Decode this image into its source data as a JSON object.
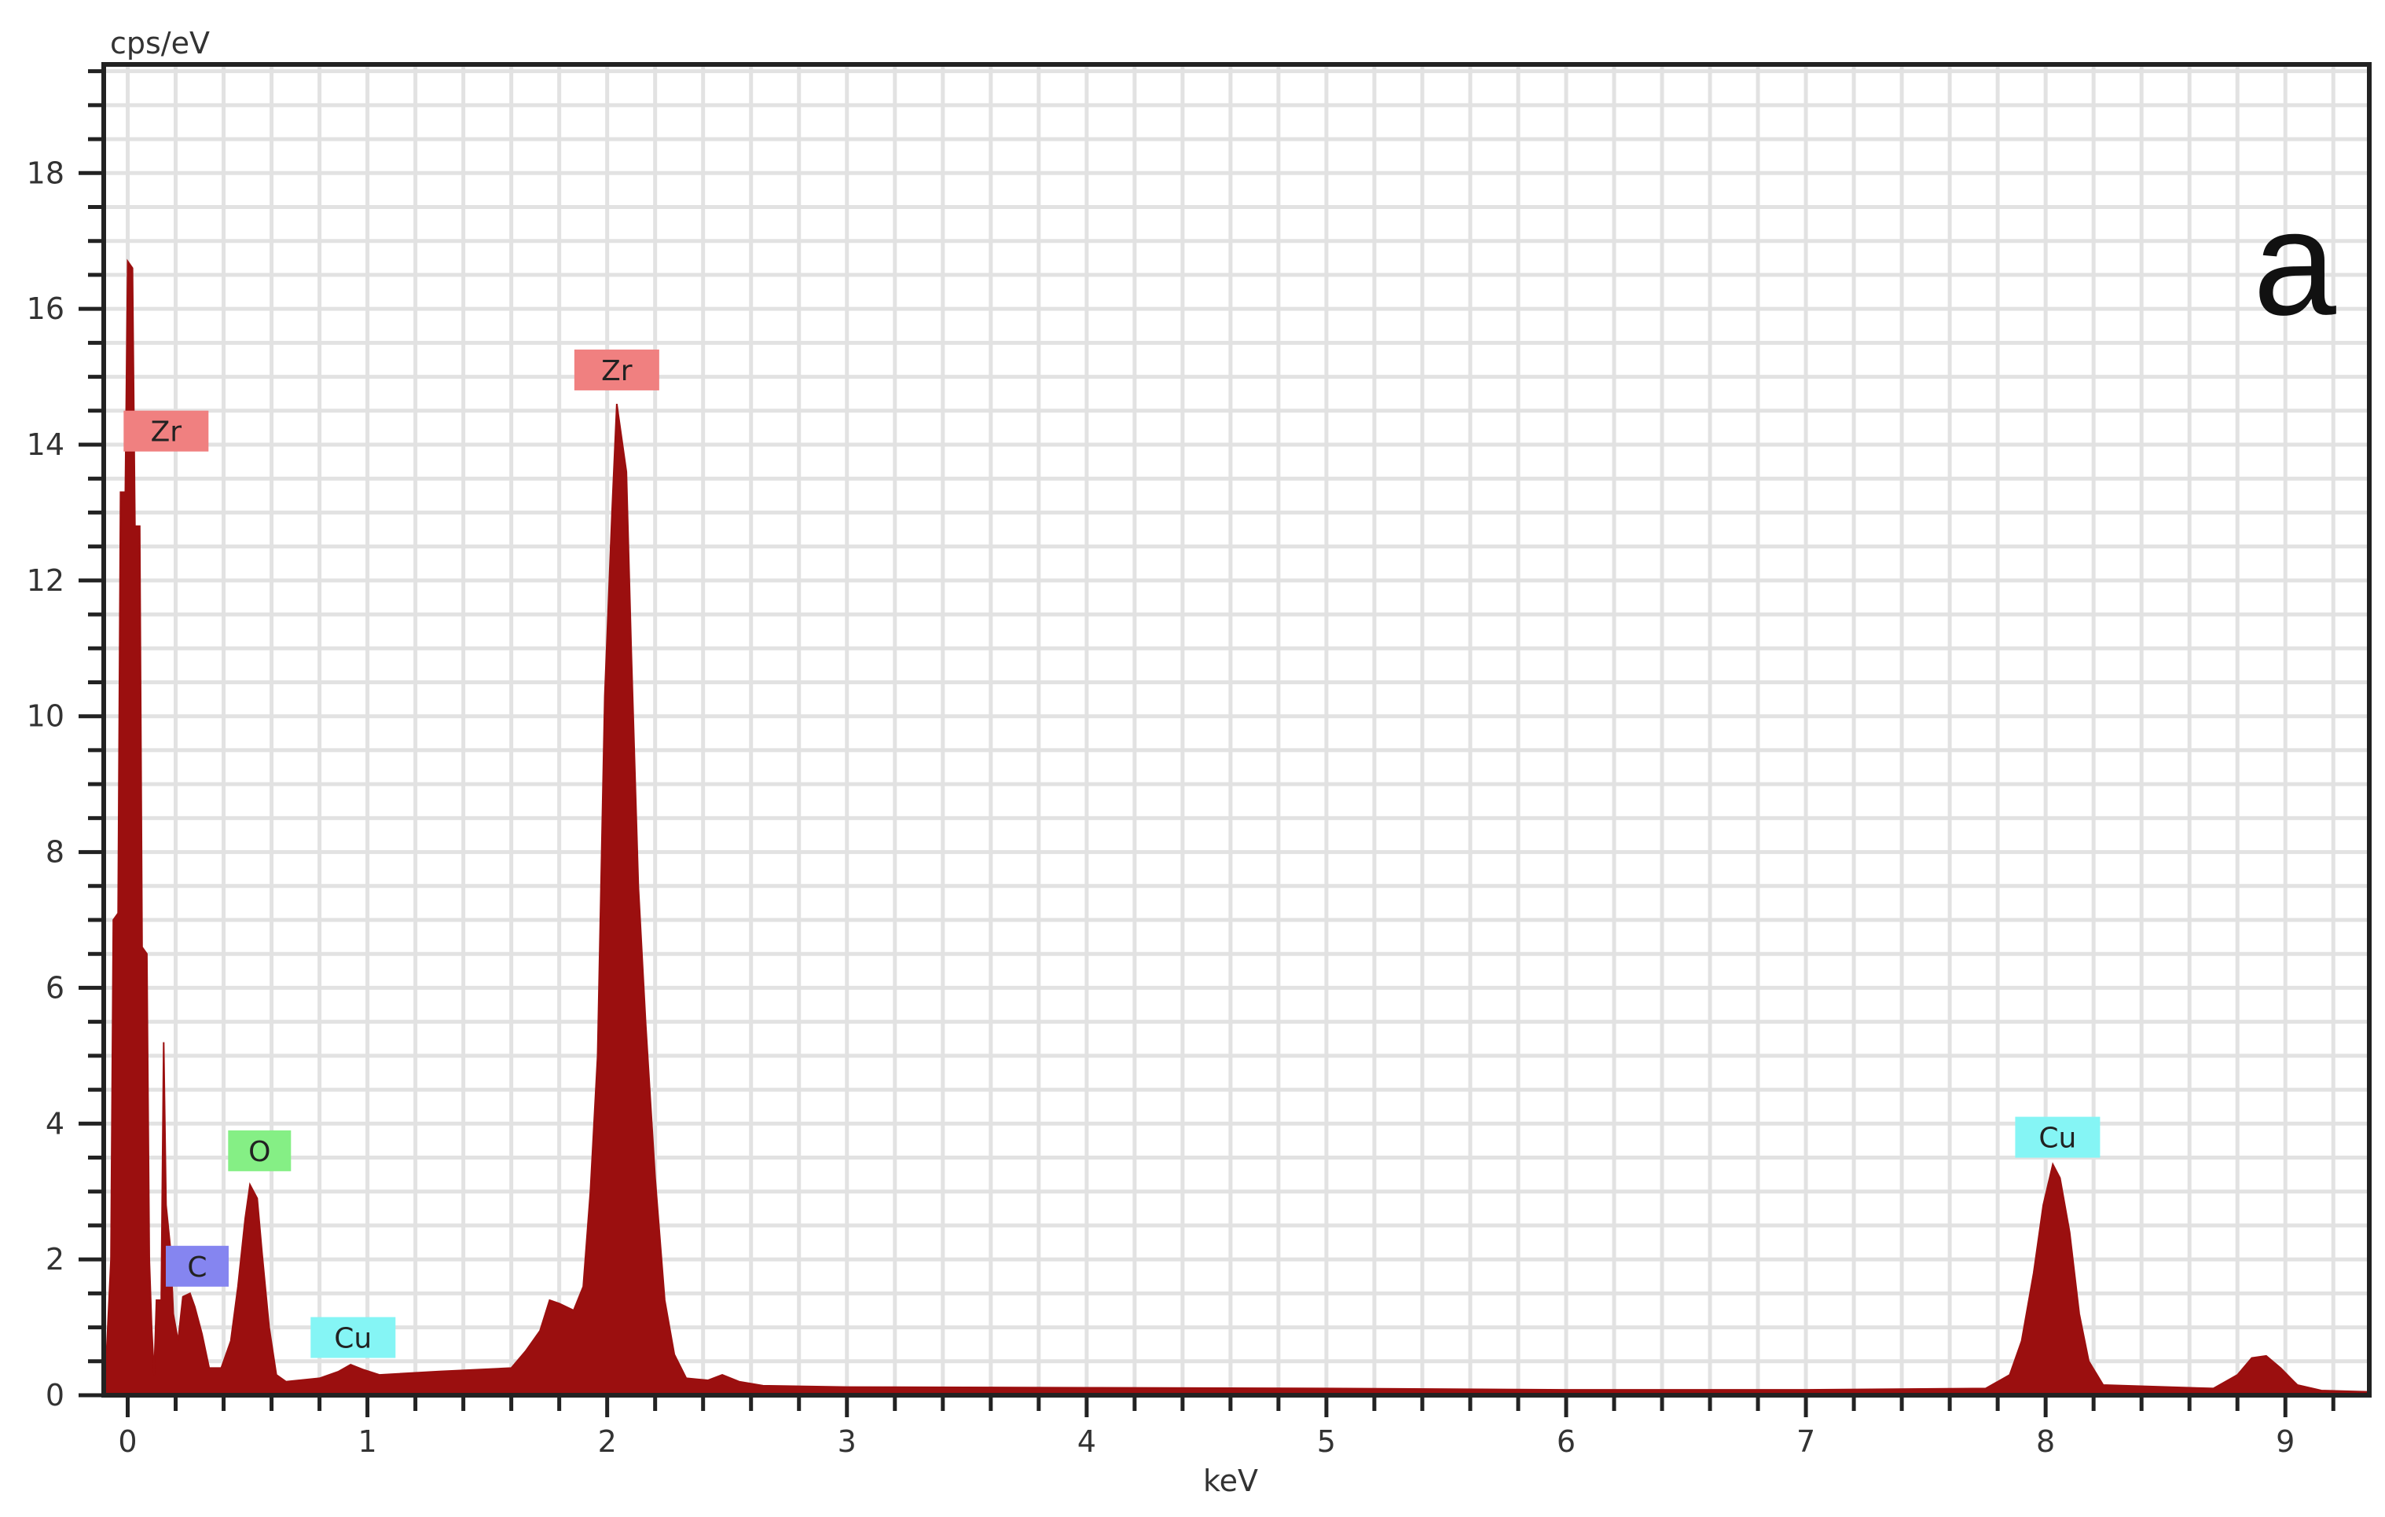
{
  "chart_data": {
    "type": "area",
    "title": "",
    "panel_label": "a",
    "xlabel": "keV",
    "ylabel": "cps/eV",
    "xlim": [
      -0.1,
      9.35
    ],
    "ylim": [
      0,
      19.6
    ],
    "grid": true,
    "x_ticks": [
      "0",
      "1",
      "2",
      "3",
      "4",
      "5",
      "6",
      "7",
      "8",
      "9"
    ],
    "y_ticks": [
      "0",
      "2",
      "4",
      "6",
      "8",
      "10",
      "12",
      "14",
      "16",
      "18"
    ],
    "series": [
      {
        "name": "EDS spectrum",
        "color": "#9b0f0f",
        "points": [
          [
            -0.1,
            0
          ],
          [
            -0.09,
            0.5
          ],
          [
            -0.07,
            2.0
          ],
          [
            -0.06,
            7.0
          ],
          [
            -0.04,
            7.1
          ],
          [
            -0.03,
            13.3
          ],
          [
            -0.01,
            13.3
          ],
          [
            0.0,
            16.7
          ],
          [
            0.02,
            16.6
          ],
          [
            0.03,
            12.8
          ],
          [
            0.05,
            12.8
          ],
          [
            0.06,
            6.6
          ],
          [
            0.08,
            6.5
          ],
          [
            0.09,
            2.0
          ],
          [
            0.1,
            1.0
          ],
          [
            0.11,
            0.3
          ],
          [
            0.12,
            1.4
          ],
          [
            0.14,
            1.4
          ],
          [
            0.15,
            5.2
          ],
          [
            0.16,
            2.8
          ],
          [
            0.18,
            2.1
          ],
          [
            0.19,
            1.2
          ],
          [
            0.21,
            0.8
          ],
          [
            0.23,
            1.45
          ],
          [
            0.26,
            1.5
          ],
          [
            0.28,
            1.3
          ],
          [
            0.31,
            0.9
          ],
          [
            0.34,
            0.4
          ],
          [
            0.39,
            0.4
          ],
          [
            0.43,
            0.8
          ],
          [
            0.46,
            1.6
          ],
          [
            0.49,
            2.6
          ],
          [
            0.51,
            3.1
          ],
          [
            0.54,
            2.9
          ],
          [
            0.56,
            2.1
          ],
          [
            0.59,
            1.0
          ],
          [
            0.62,
            0.3
          ],
          [
            0.66,
            0.2
          ],
          [
            0.8,
            0.25
          ],
          [
            0.88,
            0.35
          ],
          [
            0.93,
            0.45
          ],
          [
            0.98,
            0.38
          ],
          [
            1.05,
            0.3
          ],
          [
            1.3,
            0.35
          ],
          [
            1.6,
            0.4
          ],
          [
            1.66,
            0.65
          ],
          [
            1.72,
            0.95
          ],
          [
            1.76,
            1.4
          ],
          [
            1.8,
            1.35
          ],
          [
            1.86,
            1.25
          ],
          [
            1.9,
            1.6
          ],
          [
            1.93,
            3.0
          ],
          [
            1.96,
            5.0
          ],
          [
            1.99,
            10.3
          ],
          [
            2.02,
            13.0
          ],
          [
            2.04,
            14.6
          ],
          [
            2.06,
            14.1
          ],
          [
            2.08,
            13.6
          ],
          [
            2.1,
            11.0
          ],
          [
            2.13,
            7.5
          ],
          [
            2.16,
            5.5
          ],
          [
            2.2,
            3.2
          ],
          [
            2.24,
            1.4
          ],
          [
            2.28,
            0.6
          ],
          [
            2.33,
            0.25
          ],
          [
            2.42,
            0.22
          ],
          [
            2.48,
            0.3
          ],
          [
            2.55,
            0.2
          ],
          [
            2.65,
            0.14
          ],
          [
            3.0,
            0.12
          ],
          [
            4.0,
            0.11
          ],
          [
            5.0,
            0.1
          ],
          [
            6.0,
            0.08
          ],
          [
            7.0,
            0.08
          ],
          [
            7.75,
            0.1
          ],
          [
            7.85,
            0.3
          ],
          [
            7.9,
            0.8
          ],
          [
            7.95,
            1.8
          ],
          [
            7.99,
            2.8
          ],
          [
            8.03,
            3.4
          ],
          [
            8.06,
            3.2
          ],
          [
            8.1,
            2.4
          ],
          [
            8.14,
            1.2
          ],
          [
            8.18,
            0.5
          ],
          [
            8.24,
            0.15
          ],
          [
            8.7,
            0.1
          ],
          [
            8.8,
            0.3
          ],
          [
            8.86,
            0.55
          ],
          [
            8.92,
            0.58
          ],
          [
            8.98,
            0.4
          ],
          [
            9.05,
            0.15
          ],
          [
            9.15,
            0.07
          ],
          [
            9.35,
            0.05
          ],
          [
            9.35,
            0
          ]
        ]
      }
    ],
    "annotations": [
      {
        "text": "Zr",
        "x": 0.16,
        "y": 14.2,
        "color": "#f08080"
      },
      {
        "text": "Zr",
        "x": 2.04,
        "y": 15.1,
        "color": "#f08080"
      },
      {
        "text": "C",
        "x": 0.29,
        "y": 1.9,
        "color": "#8585f0"
      },
      {
        "text": "O",
        "x": 0.55,
        "y": 3.6,
        "color": "#85ef85"
      },
      {
        "text": "Cu",
        "x": 0.94,
        "y": 0.85,
        "color": "#85f5f5"
      },
      {
        "text": "Cu",
        "x": 8.05,
        "y": 3.8,
        "color": "#85f5f5"
      }
    ]
  }
}
